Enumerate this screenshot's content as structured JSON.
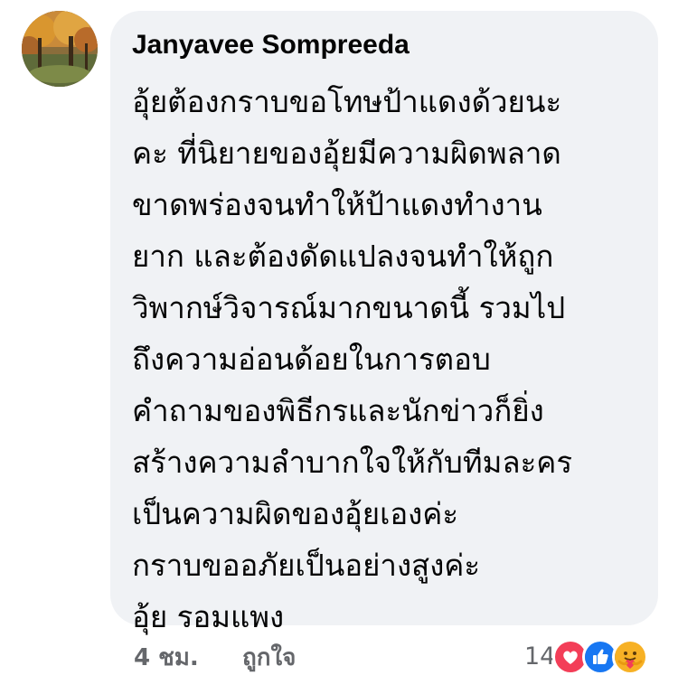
{
  "comment": {
    "author": "Janyavee Sompreeda",
    "lines": [
      "อุ้ยต้องกราบขอโทษป้าแดงด้วยนะ",
      "คะ ที่นิยายของอุ้ยมีความผิดพลาด",
      "ขาดพร่องจนทำให้ป้าแดงทำงาน",
      "ยาก และต้องดัดแปลงจนทำให้ถูก",
      "วิพากษ์วิจารณ์มากขนาดนี้ รวมไป",
      "ถึงความอ่อนด้อยในการตอบ",
      "คำถามของพิธีกรและนักข่าวก็ยิ่ง",
      "สร้างความลำบากใจให้กับทีมละคร",
      "เป็นความผิดของอุ้ยเองค่ะ",
      "กราบขออภัยเป็นอย่างสูงค่ะ",
      "อุ้ย รอมแพง"
    ]
  },
  "footer": {
    "timestamp": "4 ชม.",
    "like_label": "ถูกใจ",
    "reaction_count": "14",
    "reactions": [
      "love-icon",
      "like-icon",
      "care-icon"
    ]
  },
  "colors": {
    "bubble_bg": "#f0f2f5",
    "meta_text": "#65676b",
    "love": "#f33e58",
    "like": "#1877f2",
    "care": "#f7b125"
  }
}
